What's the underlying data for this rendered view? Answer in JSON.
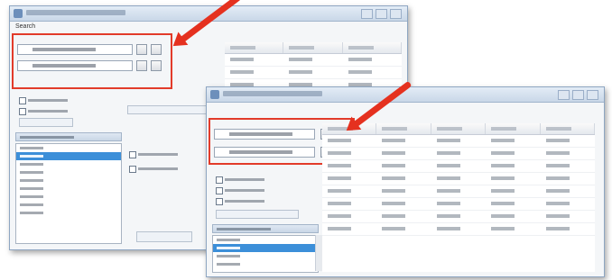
{
  "back_window": {
    "menu_label": "Search",
    "rows": 3,
    "list_items": 9,
    "selected_list_index": 1
  },
  "front_window": {
    "rows": 8,
    "list_items": 4,
    "selected_list_index": 1
  },
  "colors": {
    "highlight": "#e23b2a",
    "selection": "#3c8fd9",
    "titlebar": "#c9d7e8"
  }
}
